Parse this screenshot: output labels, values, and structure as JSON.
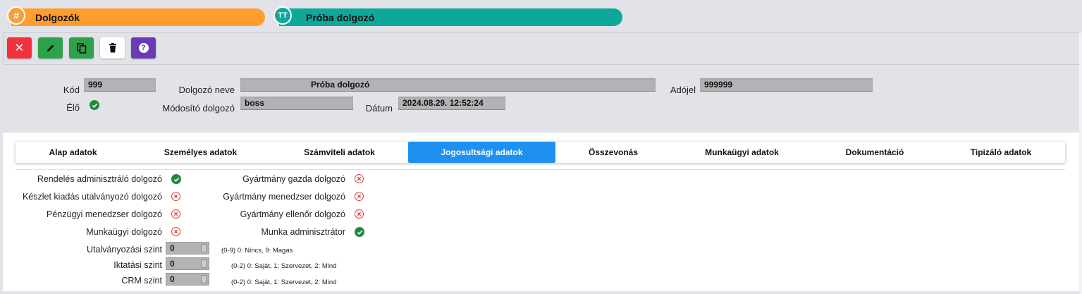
{
  "breadcrumb": {
    "section": {
      "label": "Dolgozók",
      "icon": "hash-icon",
      "glyph": "#",
      "color": "#ff9d2e"
    },
    "record": {
      "label": "Próba dolgozó",
      "icon": "text-type-icon",
      "glyph": "TT",
      "color": "#0ea89a"
    }
  },
  "toolbar": {
    "buttons": [
      {
        "name": "close",
        "icon": "close-icon",
        "color": "#f0323c"
      },
      {
        "name": "edit",
        "icon": "pencil-icon",
        "color": "#2ea24a"
      },
      {
        "name": "copy",
        "icon": "copy-icon",
        "color": "#2ea24a"
      },
      {
        "name": "delete",
        "icon": "trash-icon",
        "color": "#ffffff"
      },
      {
        "name": "help",
        "icon": "help-icon",
        "color": "#6a3bb5"
      }
    ]
  },
  "header": {
    "kod_label": "Kód",
    "kod_value": "999",
    "elo_label": "Élő",
    "nev_label": "Dolgozó neve",
    "nev_value": "Próba dolgozó",
    "modosito_label": "Módosító dolgozó",
    "modosito_value": "boss",
    "datum_label": "Dátum",
    "datum_value": "2024.08.29. 12:52:24",
    "adojel_label": "Adójel",
    "adojel_value": "999999"
  },
  "tabs": [
    {
      "label": "Alap adatok",
      "active": false
    },
    {
      "label": "Személyes adatok",
      "active": false
    },
    {
      "label": "Számviteli adatok",
      "active": false
    },
    {
      "label": "Jogosultsági adatok",
      "active": true
    },
    {
      "label": "Összevonás",
      "active": false
    },
    {
      "label": "Munkaügyi adatok",
      "active": false
    },
    {
      "label": "Dokumentáció",
      "active": false
    },
    {
      "label": "Tipizáló adatok",
      "active": false
    }
  ],
  "permissions_left": [
    {
      "label": "Rendelés adminisztráló dolgozó",
      "value": true
    },
    {
      "label": "Készlet kiadás utalványozó dolgozó",
      "value": false
    },
    {
      "label": "Pénzügyi menedzser dolgozó",
      "value": false
    },
    {
      "label": "Munkaügyi dolgozó",
      "value": false
    }
  ],
  "permissions_right": [
    {
      "label": "Gyártmány gazda dolgozó",
      "value": false
    },
    {
      "label": "Gyártmány menedzser dolgozó",
      "value": false
    },
    {
      "label": "Gyártmány ellenőr dolgozó",
      "value": false
    },
    {
      "label": "Munka adminisztrátor",
      "value": true
    }
  ],
  "levels": [
    {
      "label": "Utalványozási szint",
      "value": "0",
      "hint": "(0-9) 0: Nincs, 9: Magas"
    },
    {
      "label": "Iktatási szint",
      "value": "0",
      "hint": "(0-2) 0: Saját, 1: Szervezet, 2: Mind"
    },
    {
      "label": "CRM szint",
      "value": "0",
      "hint": "(0-2) 0: Saját, 1: Szervezet, 2: Mind"
    }
  ],
  "colors": {
    "ok": "#1f8a3a",
    "no": "#e53935",
    "accent": "#1e90f0"
  }
}
